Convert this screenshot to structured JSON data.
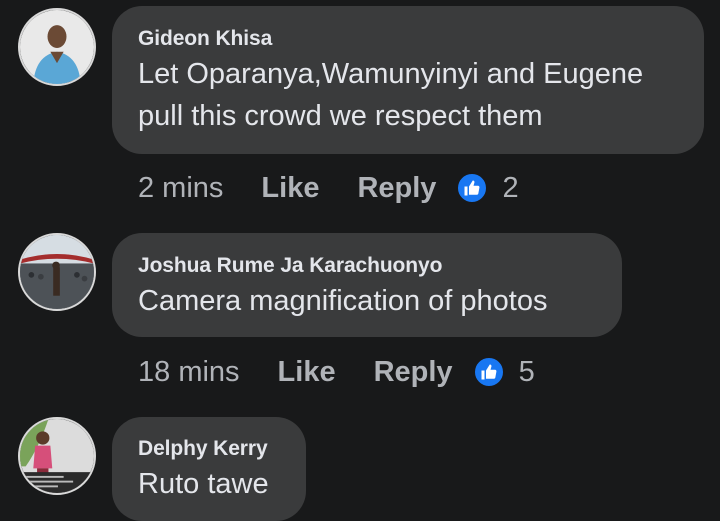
{
  "comments": [
    {
      "author": "Gideon Khisa",
      "text_lines": [
        "Let Oparanya,Wamunyinyi and Eugene",
        "pull this crowd we respect them"
      ],
      "time": "2 mins",
      "like_label": "Like",
      "reply_label": "Reply",
      "reaction_count": "2",
      "reaction_icon": "thumbs-up-icon"
    },
    {
      "author": "Joshua Rume Ja Karachuonyo",
      "text_lines": [
        "Camera magnification of photos"
      ],
      "time": "18 mins",
      "like_label": "Like",
      "reply_label": "Reply",
      "reaction_count": "5",
      "reaction_icon": "thumbs-up-icon"
    },
    {
      "author": "Delphy Kerry",
      "text_lines": [
        "Ruto tawe"
      ]
    }
  ],
  "colors": {
    "background": "#18191a",
    "bubble": "#3a3b3c",
    "text": "#e4e6eb",
    "secondary_text": "#b0b3b8",
    "like_badge": "#1877f2"
  }
}
